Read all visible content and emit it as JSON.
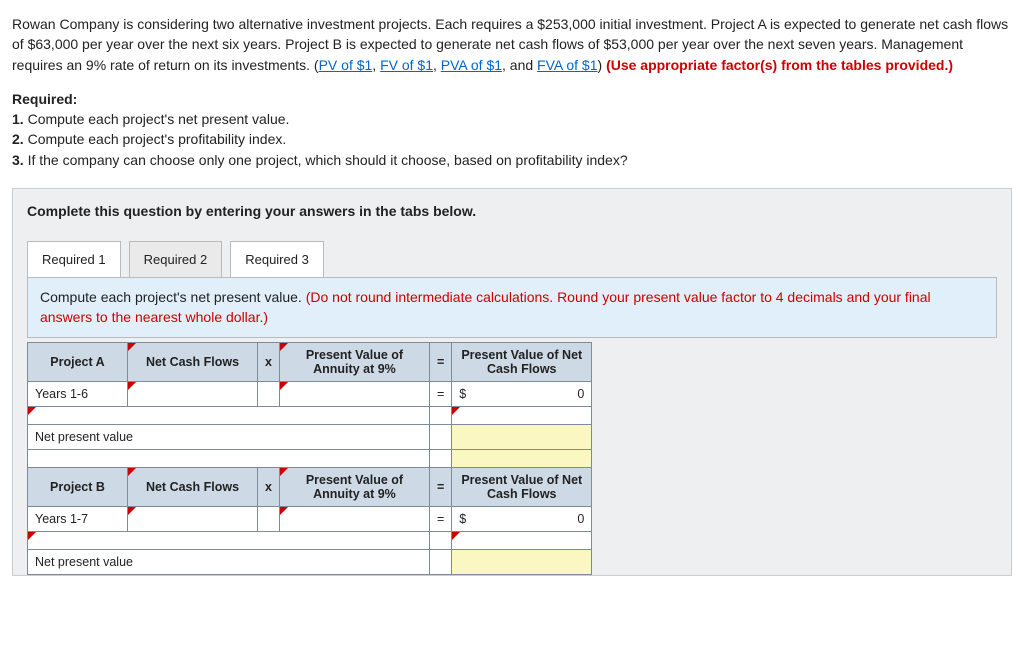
{
  "problem": {
    "intro": "Rowan Company is considering two alternative investment projects. Each requires a $253,000 initial investment. Project A is expected to generate net cash flows of $63,000 per year over the next six years. Project B is expected to generate net cash flows of $53,000 per year over the next seven years. Management requires an 9% rate of return on its investments. (",
    "pv_link": "PV of $1",
    "fv_link": "FV of $1",
    "pva_link": "PVA of $1",
    "fva_link": "FVA of $1",
    "sep": ", ",
    "and": ", and ",
    "close": ") ",
    "use_tables": "(Use appropriate factor(s) from the tables provided.)"
  },
  "required": {
    "heading": "Required:",
    "r1": "1. Compute each project's net present value.",
    "r2": "2. Compute each project's profitability index.",
    "r3": "3. If the company can choose only one project, which should it choose, based on profitability index?"
  },
  "tabs": {
    "instruction": "Complete this question by entering your answers in the tabs below.",
    "t1": "Required 1",
    "t2": "Required 2",
    "t3": "Required 3"
  },
  "tab1": {
    "prompt_a": "Compute each project's net present value. ",
    "prompt_b": "(Do not round intermediate calculations. Round your present value factor to 4 decimals and your final answers to the nearest whole dollar.)"
  },
  "headers": {
    "ncf": "Net Cash Flows",
    "x": "x",
    "pva": "Present Value of Annuity at 9%",
    "eq": "=",
    "pvn": "Present Value of Net Cash Flows"
  },
  "projA": {
    "title": "Project A",
    "years": "Years 1-6",
    "npv": "Net present value",
    "dollar": "$",
    "zero": "0"
  },
  "projB": {
    "title": "Project B",
    "years": "Years 1-7",
    "npv": "Net present value",
    "dollar": "$",
    "zero": "0"
  }
}
